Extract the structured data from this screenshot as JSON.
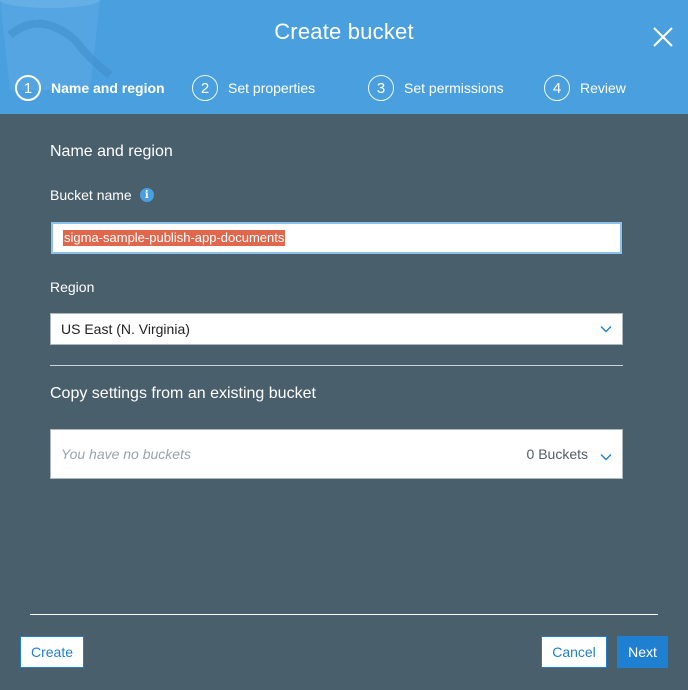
{
  "dialog": {
    "title": "Create bucket"
  },
  "steps": [
    {
      "number": "1",
      "label": "Name and region",
      "active": true
    },
    {
      "number": "2",
      "label": "Set properties",
      "active": false
    },
    {
      "number": "3",
      "label": "Set permissions",
      "active": false
    },
    {
      "number": "4",
      "label": "Review",
      "active": false
    }
  ],
  "name_and_region": {
    "section_title": "Name and region",
    "bucket_name_label": "Bucket name",
    "bucket_name_value": "sigma-sample-publish-app-documents",
    "region_label": "Region",
    "region_value": "US East (N. Virginia)"
  },
  "copy_settings": {
    "section_title": "Copy settings from an existing bucket",
    "placeholder": "You have no buckets",
    "bucket_count": "0 Buckets"
  },
  "footer": {
    "create_label": "Create",
    "cancel_label": "Cancel",
    "next_label": "Next"
  },
  "colors": {
    "header_bg": "#4a9fdf",
    "body_bg": "#4a5f6c",
    "primary": "#1f7fd1",
    "selection": "#e0674b"
  },
  "icons": {
    "close": "close-icon",
    "info": "info-icon",
    "chevron": "chevron-down-icon"
  }
}
